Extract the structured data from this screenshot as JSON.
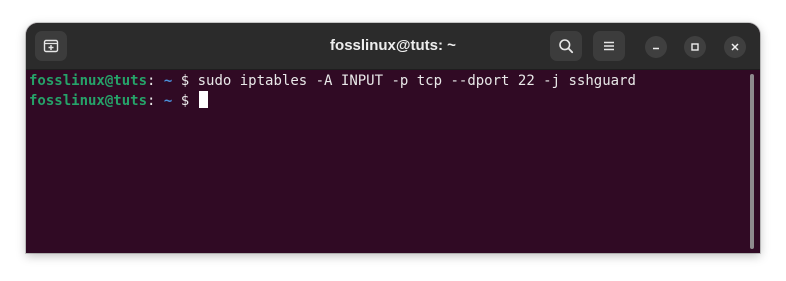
{
  "window": {
    "title": "fosslinux@tuts: ~"
  },
  "titlebar": {
    "buttons": {
      "new_tab": "new-tab-icon",
      "search": "search-icon",
      "menu": "hamburger-menu-icon",
      "minimize": "minimize-icon",
      "maximize": "maximize-icon",
      "close": "close-icon"
    }
  },
  "terminal": {
    "lines": [
      {
        "user_host": "fosslinux@tuts",
        "separator": ":",
        "path": " ~",
        "prompt": " $ ",
        "command": "sudo iptables -A INPUT -p tcp --dport 22 -j sshguard"
      },
      {
        "user_host": "fosslinux@tuts",
        "separator": ":",
        "path": " ~",
        "prompt": " $ ",
        "command": ""
      }
    ]
  },
  "colors": {
    "background": "#300a24",
    "titlebar": "#2b2b2b",
    "user_host": "#26a269",
    "path": "#4a8ed8",
    "text": "#e8e8e8"
  }
}
